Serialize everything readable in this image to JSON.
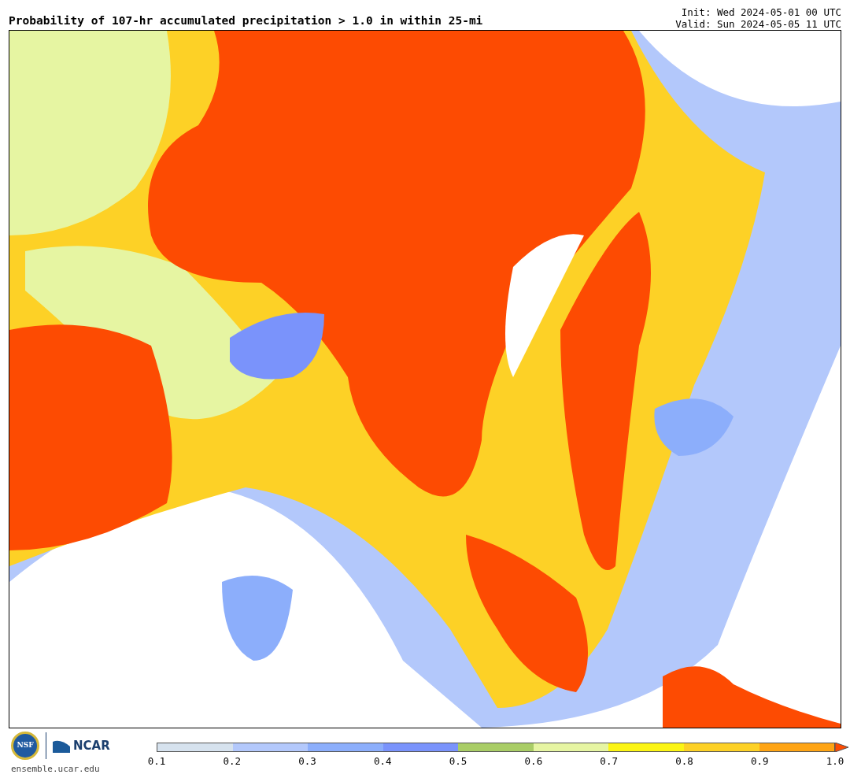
{
  "header": {
    "title": "Probability of 107-hr accumulated precipitation > 1.0 in within 25-mi",
    "init": "Init: Wed 2024-05-01 00 UTC",
    "valid": "Valid: Sun 2024-05-05 11 UTC"
  },
  "footer": {
    "logos": [
      "NSF",
      "NCAR"
    ],
    "site": "ensemble.ucar.edu"
  },
  "legend": {
    "bins": [
      {
        "color": "#d6e2ee"
      },
      {
        "color": "#b3c8fb"
      },
      {
        "color": "#8caefb"
      },
      {
        "color": "#7a93fb"
      },
      {
        "color": "#a9cd66"
      },
      {
        "color": "#e6f5a2"
      },
      {
        "color": "#fcf514"
      },
      {
        "color": "#fdd126"
      },
      {
        "color": "#fea414"
      },
      {
        "color": "#fd4b02"
      }
    ],
    "ticks": [
      "0.1",
      "0.2",
      "0.3",
      "0.4",
      "0.5",
      "0.6",
      "0.7",
      "0.8",
      "0.9",
      "1.0"
    ]
  }
}
